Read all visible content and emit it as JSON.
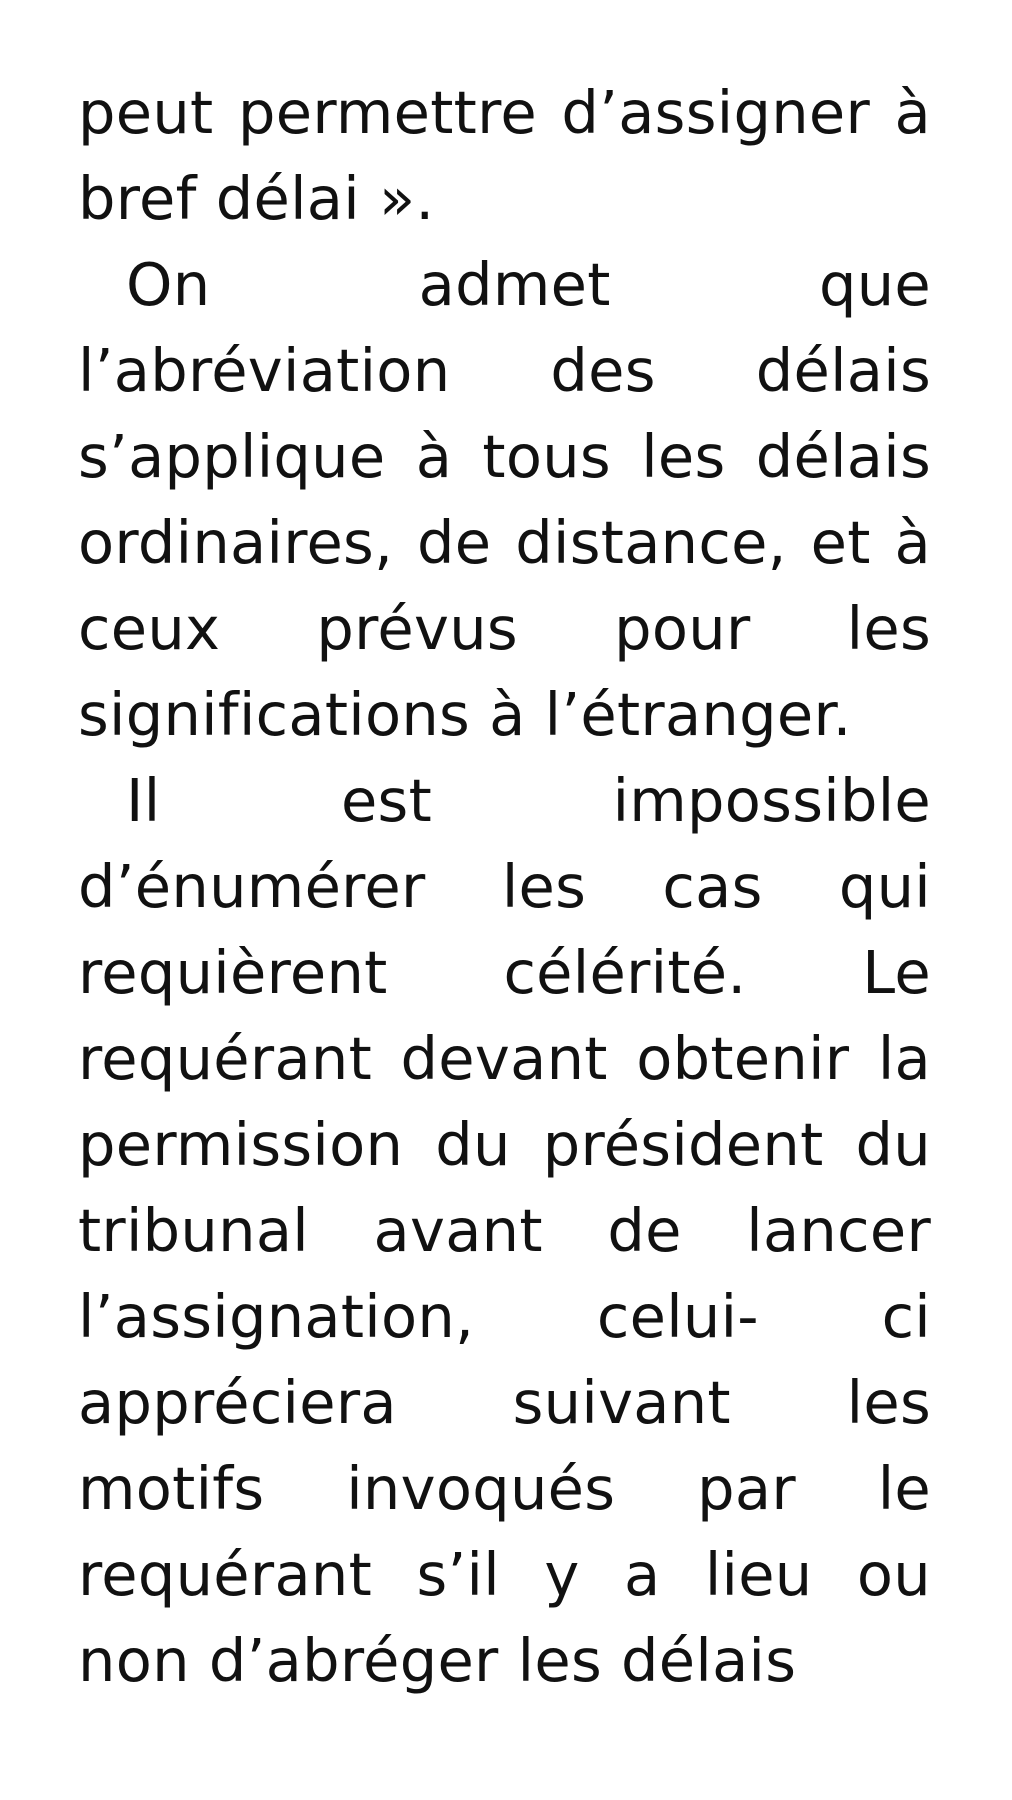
{
  "document": {
    "paragraphs": [
      {
        "text": "peut permettre d’assigner à bref délai »."
      },
      {
        "text": "On admet que l’abréviation des délais s’applique à tous les délais ordinaires, de distance, et à ceux prévus pour les significations à l’étranger."
      },
      {
        "text": "Il est impossible d’énumérer les cas qui requièrent célérité. Le requérant devant obtenir la permission du président du tribunal avant de lancer l’assignation, celui- ci appréciera suivant les motifs invoqués par le requérant s’il y a lieu ou non d’abréger les délais"
      }
    ]
  }
}
